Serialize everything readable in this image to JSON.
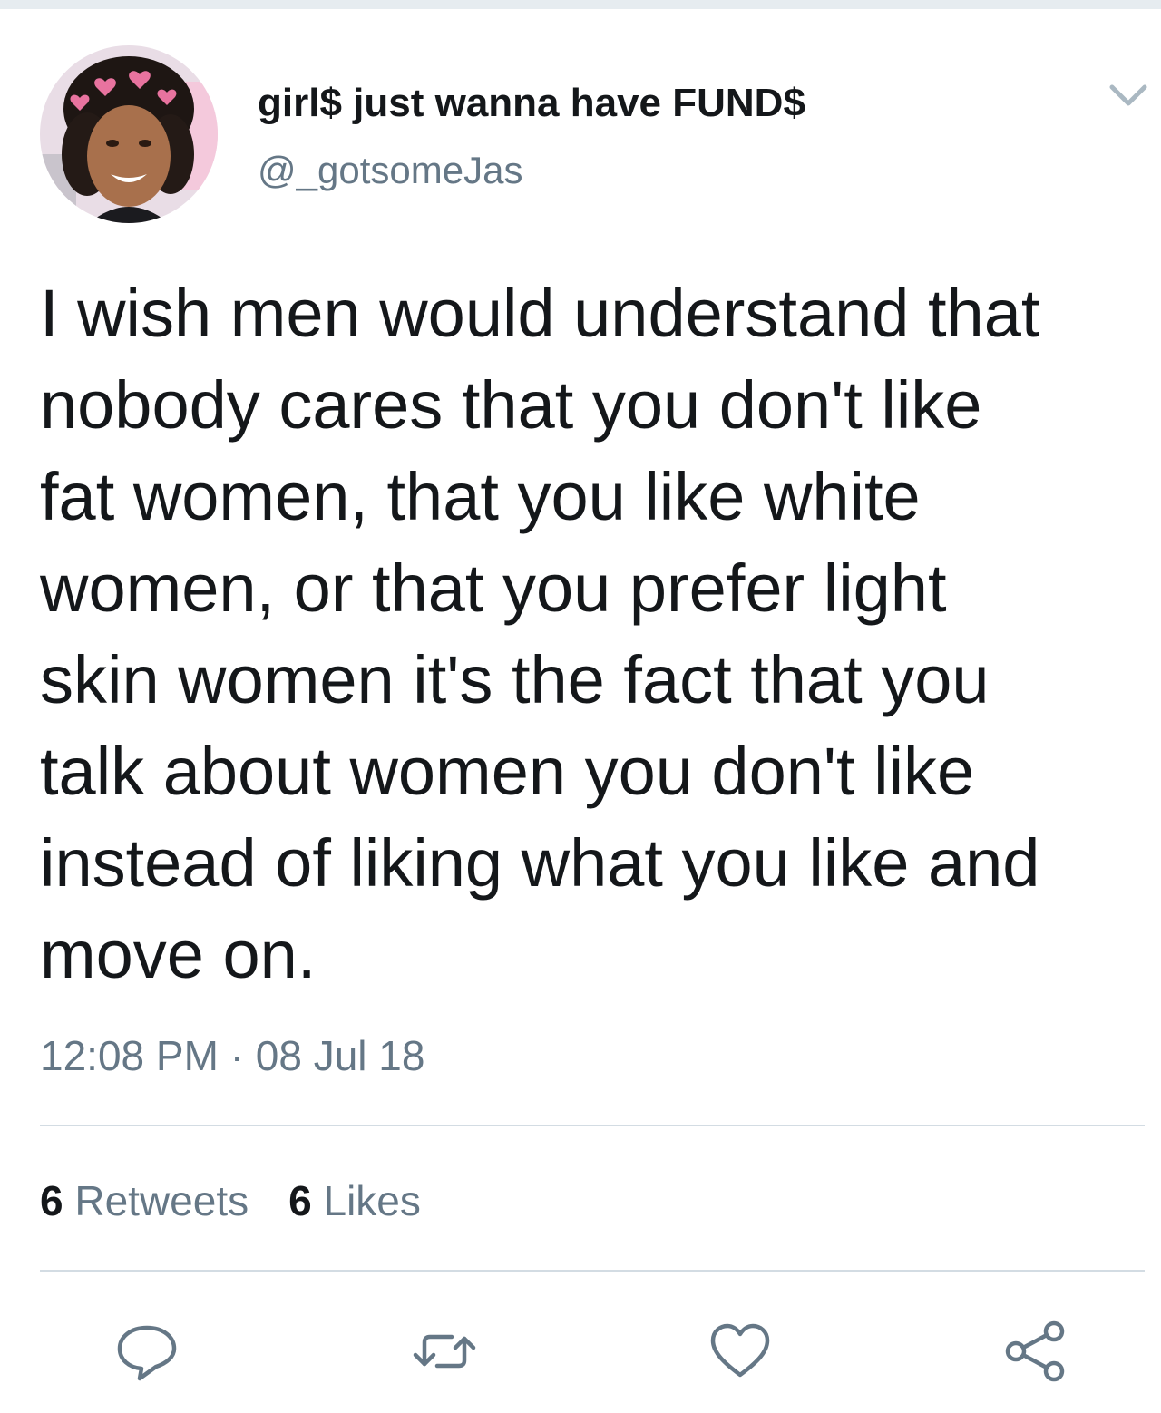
{
  "tweet": {
    "author": {
      "display_name": "girl$ just wanna have FUND$",
      "handle": "@_gotsomeJas",
      "avatar_icon": "profile-photo"
    },
    "text": "I wish men would understand that\nnobody cares that you don't like\nfat women, that you like white\nwomen, or that you prefer light\nskin women it's the fact that you\ntalk about women you don't like\ninstead of liking what you like and\nmove on.",
    "timestamp": "12:08 PM · 08 Jul 18",
    "stats": {
      "retweets_count": "6",
      "retweets_label": "Retweets",
      "likes_count": "6",
      "likes_label": "Likes"
    },
    "actions": [
      {
        "name": "reply",
        "icon": "speech-bubble-icon"
      },
      {
        "name": "retweet",
        "icon": "retweet-arrows-icon"
      },
      {
        "name": "like",
        "icon": "heart-icon"
      },
      {
        "name": "share",
        "icon": "share-nodes-icon"
      }
    ]
  },
  "colors": {
    "text_primary": "#14171a",
    "text_secondary": "#657786",
    "divider": "#d3dce3",
    "icon": "#657786"
  }
}
